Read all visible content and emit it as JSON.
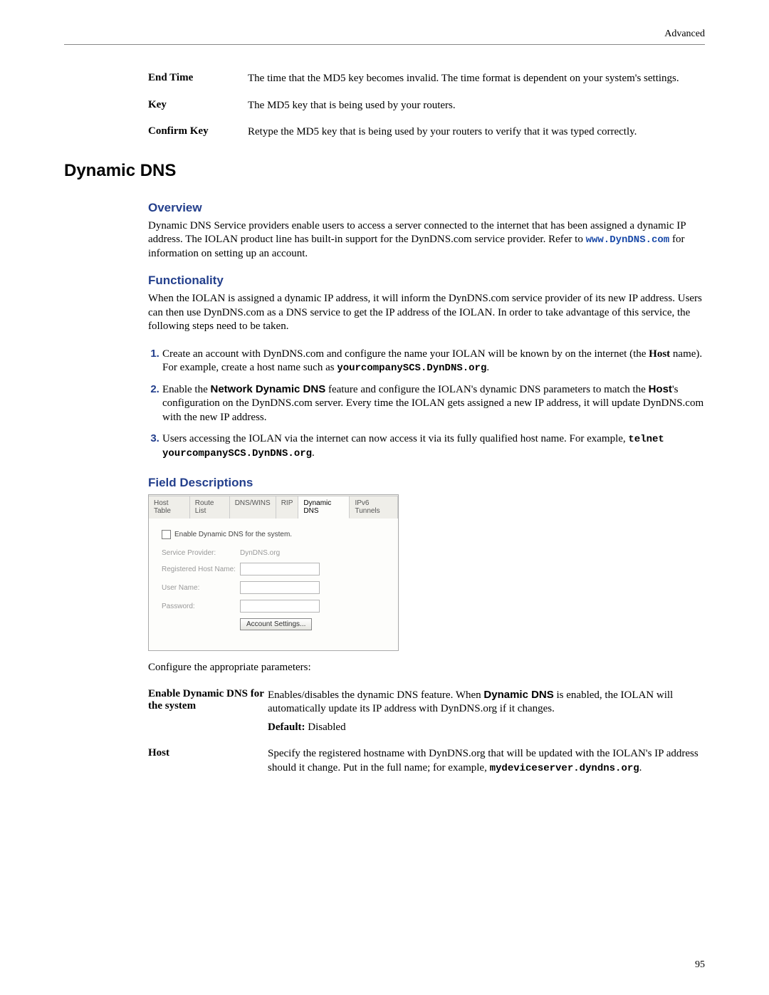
{
  "header": {
    "right": "Advanced"
  },
  "intro_fields": [
    {
      "label": "End Time",
      "desc": "The time that the MD5 key becomes invalid. The time format is dependent on your system's settings."
    },
    {
      "label": "Key",
      "desc": "The MD5 key that is being used by your routers."
    },
    {
      "label": "Confirm Key",
      "desc": "Retype the MD5 key that is being used by your routers to verify that it was typed correctly."
    }
  ],
  "h1": "Dynamic DNS",
  "overview": {
    "title": "Overview",
    "text_pre": "Dynamic DNS Service providers enable users to access a server connected to the internet that has been assigned a dynamic IP address. The IOLAN product line has built-in support for the DynDNS.com service provider. Refer to ",
    "link": "www.DynDNS.com",
    "text_post": " for information on setting up an account."
  },
  "functionality": {
    "title": "Functionality",
    "intro": "When the IOLAN is assigned a dynamic IP address, it will inform the DynDNS.com service provider of its new IP address. Users can then use DynDNS.com as a DNS service to get the IP address of the IOLAN. In order to take advantage of this service, the following steps need to be taken.",
    "steps": {
      "s1_a": "Create an account with DynDNS.com and configure the name your IOLAN will be known by on the internet (the ",
      "s1_host_bold": "Host",
      "s1_b": " name). For example, create a host name such as ",
      "s1_mono": "yourcompanySCS.DynDNS.org",
      "s1_c": ".",
      "s2_a": "Enable the ",
      "s2_feat_bold": "Network Dynamic DNS",
      "s2_b": " feature and configure the IOLAN's dynamic DNS parameters to match the ",
      "s2_host_bold": "Host",
      "s2_c": "'s configuration on the DynDNS.com server. Every time the IOLAN gets assigned a new IP address, it will update DynDNS.com with the new IP address.",
      "s3_a": "Users accessing the IOLAN via the internet can now access it via its fully qualified host name. For example, ",
      "s3_mono": "telnet yourcompanySCS.DynDNS.org",
      "s3_b": "."
    }
  },
  "field_desc": {
    "title": "Field Descriptions",
    "tabs": [
      "Host Table",
      "Route List",
      "DNS/WINS",
      "RIP",
      "Dynamic DNS",
      "IPv6 Tunnels"
    ],
    "checkbox_label": "Enable Dynamic DNS for the system.",
    "form": {
      "sp_label": "Service Provider:",
      "sp_value": "DynDNS.org",
      "rh_label": "Registered Host Name:",
      "un_label": "User Name:",
      "pw_label": "Password:",
      "button": "Account Settings..."
    },
    "config_line": "Configure the appropriate parameters:",
    "rows": {
      "r1_label": "Enable Dynamic DNS for the system",
      "r1_a": "Enables/disables the dynamic DNS feature. When ",
      "r1_bold": "Dynamic DNS",
      "r1_b": " is enabled, the IOLAN will automatically update its IP address with DynDNS.org if it changes.",
      "r1_default_label": "Default:",
      "r1_default_value": " Disabled",
      "r2_label": "Host",
      "r2_a": "Specify the registered hostname with DynDNS.org that will be updated with the IOLAN's IP address should it change. Put in the full name; for example, ",
      "r2_mono": "mydeviceserver.dyndns.org",
      "r2_b": "."
    }
  },
  "page_number": "95"
}
